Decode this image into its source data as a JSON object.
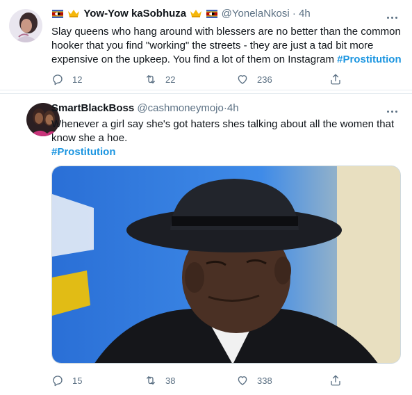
{
  "tweets": [
    {
      "display_name": "Yow-Yow kaSobhuza",
      "handle": "@YonelaNkosi",
      "separator": "·",
      "time": "4h",
      "text_main": "Slay queens who hang around with blessers are no better than the common hooker that you find \"working\" the streets - they are just a tad bit more expensive on the upkeep. You find a lot of them on Instagram ",
      "hashtag": "#Prostitution",
      "replies": "12",
      "retweets": "22",
      "likes": "236"
    },
    {
      "display_name": "SmartBlackBoss",
      "handle": "@cashmoneymojo",
      "separator": "·",
      "time": "4h",
      "text_main": "Whenever a girl say she's got haters shes talking about all the women that know she a hoe.",
      "hashtag": "#Prostitution",
      "replies": "15",
      "retweets": "38",
      "likes": "338"
    }
  ],
  "icons": {
    "reply": "reply-icon",
    "retweet": "retweet-icon",
    "like": "heart-icon",
    "share": "share-icon",
    "more": "more-icon"
  },
  "colors": {
    "hashtag": "#1b95e0",
    "secondary_text": "#5b7083",
    "divider": "#e6ecf0"
  }
}
